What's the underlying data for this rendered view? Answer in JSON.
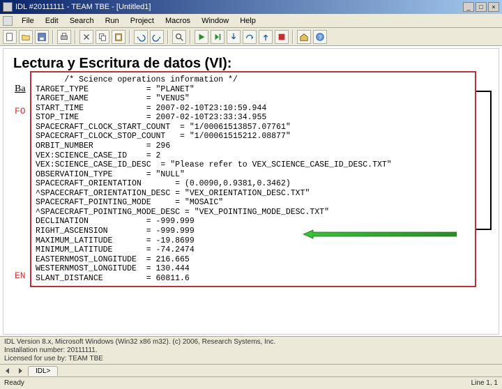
{
  "window": {
    "title": "IDL #20111111 - TEAM TBE - [Untitled1]"
  },
  "menu": {
    "items": [
      "File",
      "Edit",
      "Search",
      "Run",
      "Project",
      "Macros",
      "Window",
      "Help"
    ]
  },
  "slide": {
    "title": "Lectura y Escritura de datos (VI):",
    "label_ba": "Ba",
    "label_fo": "FO",
    "label_en": "EN"
  },
  "code": {
    "lines": [
      "      /* Science operations information */",
      "TARGET_TYPE            = \"PLANET\"",
      "TARGET_NAME            = \"VENUS\"",
      "START_TIME             = 2007-02-10T23:10:59.944",
      "STOP_TIME              = 2007-02-10T23:33:34.955",
      "SPACECRAFT_CLOCK_START_COUNT  = \"1/00061513857.07761\"",
      "SPACECRAFT_CLOCK_STOP_COUNT   = \"1/00061515212.08877\"",
      "ORBIT_NUMBER           = 296",
      "VEX:SCIENCE_CASE_ID    = 2",
      "VEX:SCIENCE_CASE_ID_DESC  = \"Please refer to VEX_SCIENCE_CASE_ID_DESC.TXT\"",
      "OBSERVATION_TYPE       = \"NULL\"",
      "SPACECRAFT_ORIENTATION       = (0.0090,0.9381,0.3462)",
      "^SPACECRAFT_ORIENTATION_DESC = \"VEX_ORIENTATION_DESC.TXT\"",
      "SPACECRAFT_POINTING_MODE     = \"MOSAIC\"",
      "^SPACECRAFT_POINTING_MODE_DESC = \"VEX_POINTING_MODE_DESC.TXT\"",
      "DECLINATION            = -999.999",
      "RIGHT_ASCENSION        = -999.999",
      "MAXIMUM_LATITUDE       = -19.8699",
      "MINIMUM_LATITUDE       = -74.2474",
      "EASTERNMOST_LONGITUDE  = 216.665",
      "WESTERNMOST_LONGITUDE  = 130.444",
      "SLANT_DISTANCE         = 60811.6"
    ]
  },
  "info": {
    "line1": "IDL Version 8.x, Microsoft Windows (Win32 x86 m32). (c) 2006, Research Systems, Inc.",
    "line2": "Installation number: 20111111.",
    "line3": "Licensed for use by: TEAM TBE"
  },
  "tabs": {
    "prompt": "IDL>"
  },
  "status": {
    "left": "Ready",
    "right": "Line 1, 1"
  },
  "icons": {
    "new": "new-file-icon",
    "open": "open-folder-icon",
    "save": "save-icon",
    "print": "print-icon",
    "cut": "cut-icon",
    "copy": "copy-icon",
    "paste": "paste-icon",
    "undo": "undo-icon",
    "redo": "redo-icon",
    "find": "find-icon",
    "run": "run-icon",
    "step": "step-icon",
    "stop": "stop-icon",
    "home": "home-icon",
    "help": "help-icon"
  }
}
